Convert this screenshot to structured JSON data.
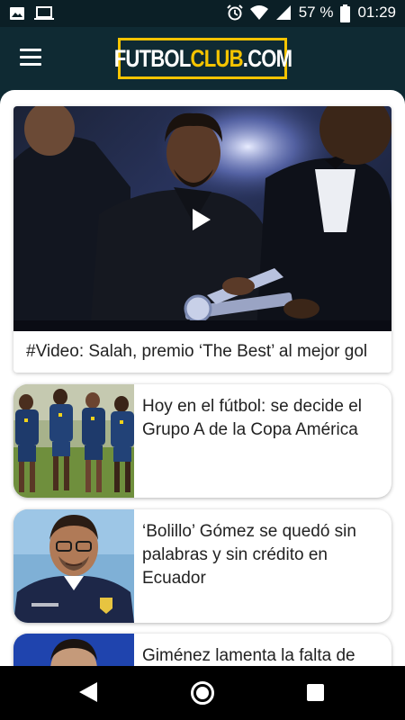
{
  "status_bar": {
    "battery_percent": "57 %",
    "time": "01:29",
    "icons": [
      "image-icon",
      "laptop-icon",
      "alarm-icon",
      "wifi-icon",
      "signal-icon",
      "battery-icon"
    ]
  },
  "header": {
    "logo_white_1": "FUTBOL",
    "logo_yellow": "CLUB",
    "logo_white_2": ".COM",
    "menu_icon": "hamburger-menu-icon",
    "accent_color": "#f5c400",
    "bar_color": "#0f2a33"
  },
  "feed": {
    "featured": {
      "title": "#Video: Salah, premio ‘The Best’ al mejor gol",
      "media_icon": "play-icon"
    },
    "items": [
      {
        "title": "Hoy en el fútbol: se decide el Grupo A de la Copa América"
      },
      {
        "title": "‘Bolillo’ Gómez se quedó sin palabras y sin crédito en Ecuador"
      },
      {
        "title": "Giménez lamenta la falta de"
      }
    ]
  },
  "nav_bar": {
    "icons": [
      "back-icon",
      "home-icon",
      "recent-apps-icon"
    ]
  }
}
